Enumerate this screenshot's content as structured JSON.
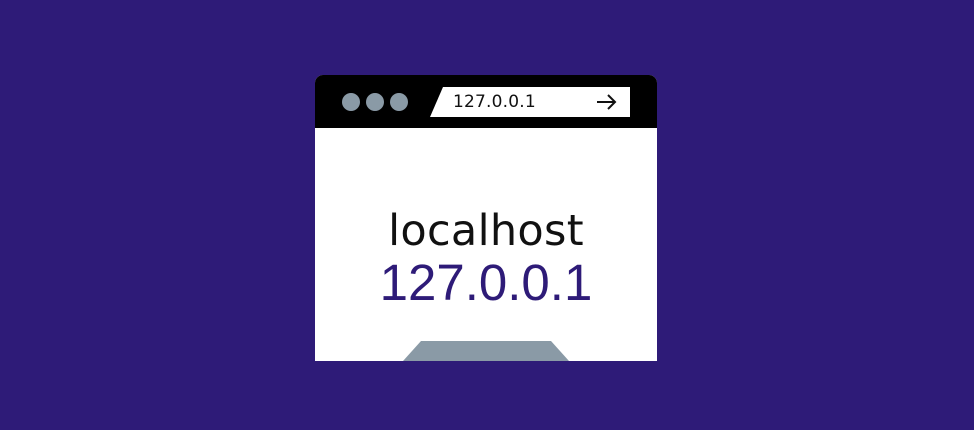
{
  "window": {
    "controls": [
      "window-dot",
      "window-dot",
      "window-dot"
    ]
  },
  "address_bar": {
    "url": "127.0.0.1",
    "go_icon": "arrow-right-icon"
  },
  "content": {
    "hostname": "localhost",
    "ip": "127.0.0.1"
  },
  "colors": {
    "background": "#2e1b78",
    "title_bar": "#000000",
    "window_body": "#ffffff",
    "dots": "#8a9aa6",
    "ip_text": "#2e1b78",
    "footer_shape": "#8a9aa6"
  }
}
